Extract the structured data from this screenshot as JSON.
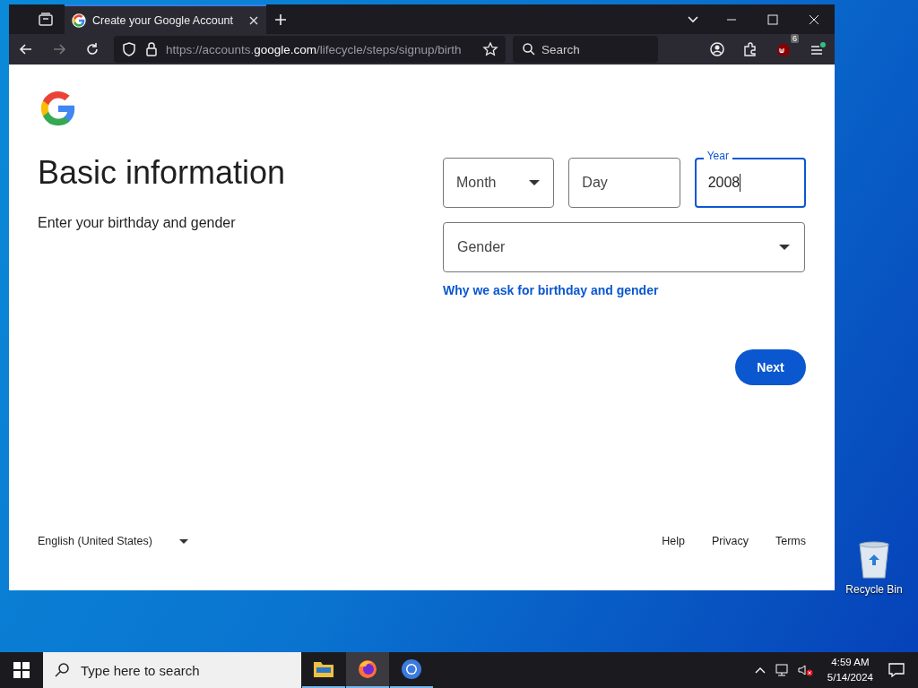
{
  "browser": {
    "tab": {
      "title": "Create your Google Account",
      "selected": true
    },
    "url": {
      "scheme": "https://accounts.",
      "domain": "google.com",
      "path": "/lifecycle/steps/signup/birth"
    },
    "search": {
      "placeholder": "Search"
    },
    "extension_badge": "6"
  },
  "page": {
    "heading": "Basic information",
    "subtitle": "Enter your birthday and gender",
    "date_fields": [
      {
        "kind": "select",
        "placeholder": "Month",
        "focused": false
      },
      {
        "kind": "input",
        "placeholder": "Day",
        "focused": false
      },
      {
        "kind": "input",
        "label": "Year",
        "value": "2008",
        "focused": true
      }
    ],
    "gender": {
      "placeholder": "Gender"
    },
    "link": "Why we ask for birthday and gender",
    "button": "Next",
    "footer": {
      "language": "English (United States)",
      "links": [
        "Help",
        "Privacy",
        "Terms"
      ]
    }
  },
  "desktop": {
    "icons": [
      {
        "kind": "recycle",
        "label": "Recycle Bin"
      }
    ]
  },
  "taskbar": {
    "search": {
      "placeholder": "Type here to search"
    },
    "apps": [
      {
        "kind": "files",
        "selected": false
      },
      {
        "kind": "firefox",
        "selected": true
      },
      {
        "kind": "chromium",
        "selected": false
      }
    ],
    "time": "4:59 AM",
    "date": "5/14/2024"
  }
}
